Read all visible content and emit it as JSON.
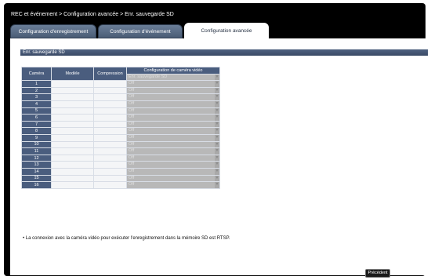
{
  "breadcrumb": "REC et événement > Configuration avancée > Enr. sauvegarde SD",
  "tabs": [
    {
      "label": "Configuration d'enregistrement",
      "active": false
    },
    {
      "label": "Configuration d'événement",
      "active": false
    },
    {
      "label": "Configuration avancée",
      "active": true
    }
  ],
  "section_title": "Enr. sauvegarde SD",
  "table": {
    "headers": {
      "camera": "Caméra",
      "model": "Modèle",
      "compression": "Compression",
      "config": "Configuration de caméra vidéo"
    },
    "all_row": {
      "value": "Enr. sauvegarde SD"
    },
    "rows": [
      {
        "camera": "1",
        "model": "",
        "compression": "",
        "value": "Off"
      },
      {
        "camera": "2",
        "model": "",
        "compression": "",
        "value": "Off"
      },
      {
        "camera": "3",
        "model": "",
        "compression": "",
        "value": "Off"
      },
      {
        "camera": "4",
        "model": "",
        "compression": "",
        "value": "Off"
      },
      {
        "camera": "5",
        "model": "",
        "compression": "",
        "value": "Off"
      },
      {
        "camera": "6",
        "model": "",
        "compression": "",
        "value": "Off"
      },
      {
        "camera": "7",
        "model": "",
        "compression": "",
        "value": "Off"
      },
      {
        "camera": "8",
        "model": "",
        "compression": "",
        "value": "Off"
      },
      {
        "camera": "9",
        "model": "",
        "compression": "",
        "value": "Off"
      },
      {
        "camera": "10",
        "model": "",
        "compression": "",
        "value": "Off"
      },
      {
        "camera": "11",
        "model": "",
        "compression": "",
        "value": "Off"
      },
      {
        "camera": "12",
        "model": "",
        "compression": "",
        "value": "Off"
      },
      {
        "camera": "13",
        "model": "",
        "compression": "",
        "value": "Off"
      },
      {
        "camera": "14",
        "model": "",
        "compression": "",
        "value": "Off"
      },
      {
        "camera": "15",
        "model": "",
        "compression": "",
        "value": "Off"
      },
      {
        "camera": "16",
        "model": "",
        "compression": "",
        "value": "Off"
      }
    ]
  },
  "note": "• La connexion avec la caméra vidéo pour exécuter l'enregistrement dans la mémoire SD est RTSP.",
  "buttons": {
    "back": "Précédent"
  }
}
